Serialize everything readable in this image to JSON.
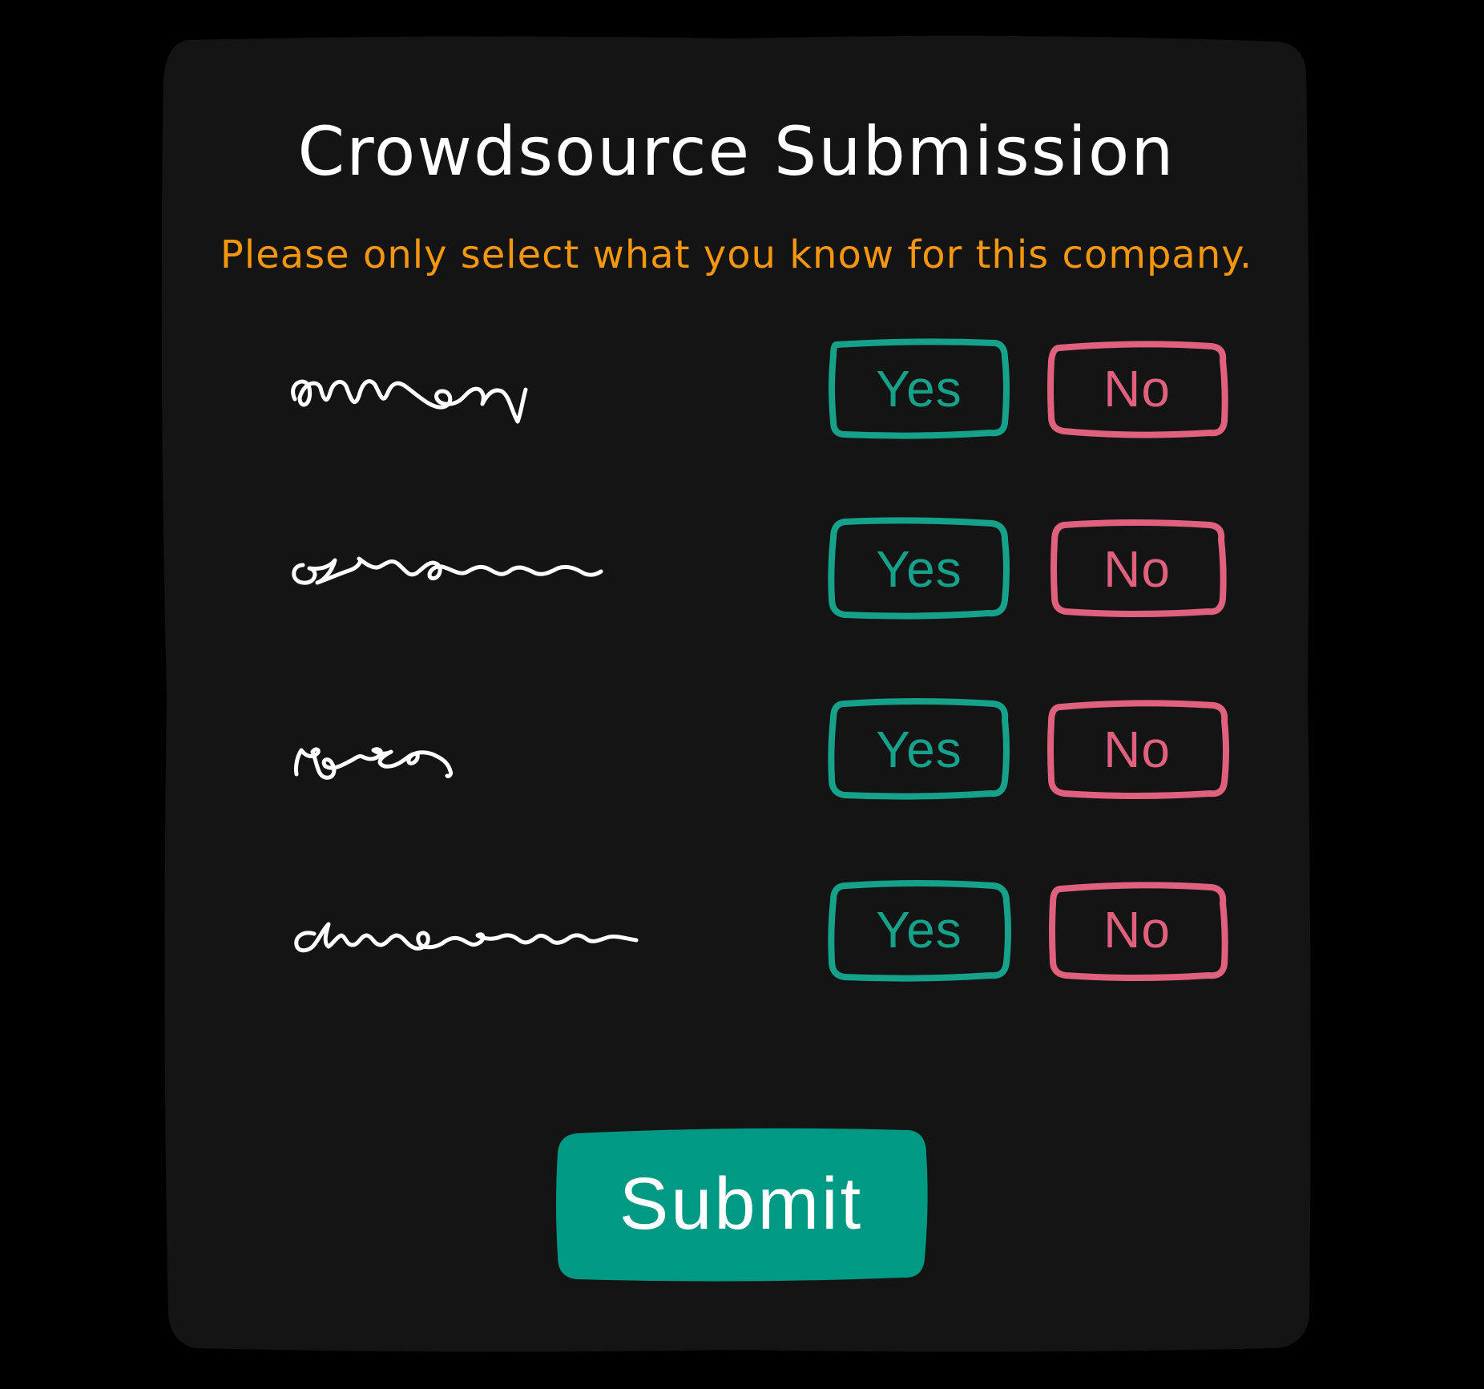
{
  "form": {
    "title": "Crowdsource Submission",
    "instruction": "Please only select what you know for this company.",
    "questions": [
      {
        "yes_label": "Yes",
        "no_label": "No"
      },
      {
        "yes_label": "Yes",
        "no_label": "No"
      },
      {
        "yes_label": "Yes",
        "no_label": "No"
      },
      {
        "yes_label": "Yes",
        "no_label": "No"
      }
    ],
    "submit_label": "Submit"
  },
  "colors": {
    "background": "#000000",
    "card": "#141414",
    "title": "#ffffff",
    "instruction": "#f5960f",
    "yes": "#16a18b",
    "no": "#e0617e",
    "submit": "#009a84"
  }
}
